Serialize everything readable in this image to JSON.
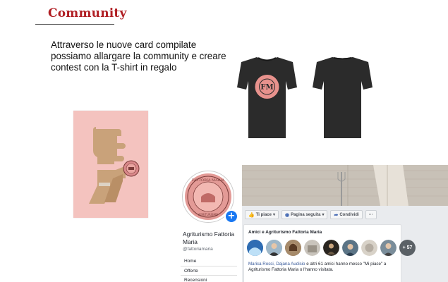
{
  "slide": {
    "title": "Community",
    "intro_lines": [
      "Attraverso le nuove card compilate",
      "possiamo allargare la community e creare",
      "contest con la T-shirt in regalo"
    ]
  },
  "card": {
    "stamp_text": "FATTORIA MARIA",
    "bottom_text": "COMMUNITY",
    "colors": {
      "background": "#f4c3bf",
      "shape": "#c9a27a",
      "stamp": "#d9888a"
    }
  },
  "tshirt": {
    "badge_text": "FM",
    "badge_ring_text": "FATTORIA MARIA",
    "colors": {
      "shirt": "#2b2b2b",
      "badge": "#e8928d"
    }
  },
  "facebook": {
    "page_name": "Agriturismo Fattoria Maria",
    "page_handle": "@fattoriamaria",
    "logo_text_top": "FATTORIA MARIA",
    "logo_text_bottom": "AGRITURISMO",
    "nav": [
      "Home",
      "Offerte",
      "Recensioni"
    ],
    "buttons": {
      "like": "Ti piace",
      "follow": "Pagina seguita",
      "share": "Condividi",
      "more": "···"
    },
    "friends": {
      "heading": "Amici e Agriturismo Fattoria Maria",
      "more_count": "+ 57",
      "names": "Marica Rossi, Dajana Audisio",
      "text": " e altri 61 amici hanno messo \"Mi piace\" a Agriturismo Fattoria Maria o l'hanno visitata."
    },
    "colors": {
      "accent": "#1877f2",
      "link": "#365899",
      "background": "#e9ebee"
    }
  }
}
